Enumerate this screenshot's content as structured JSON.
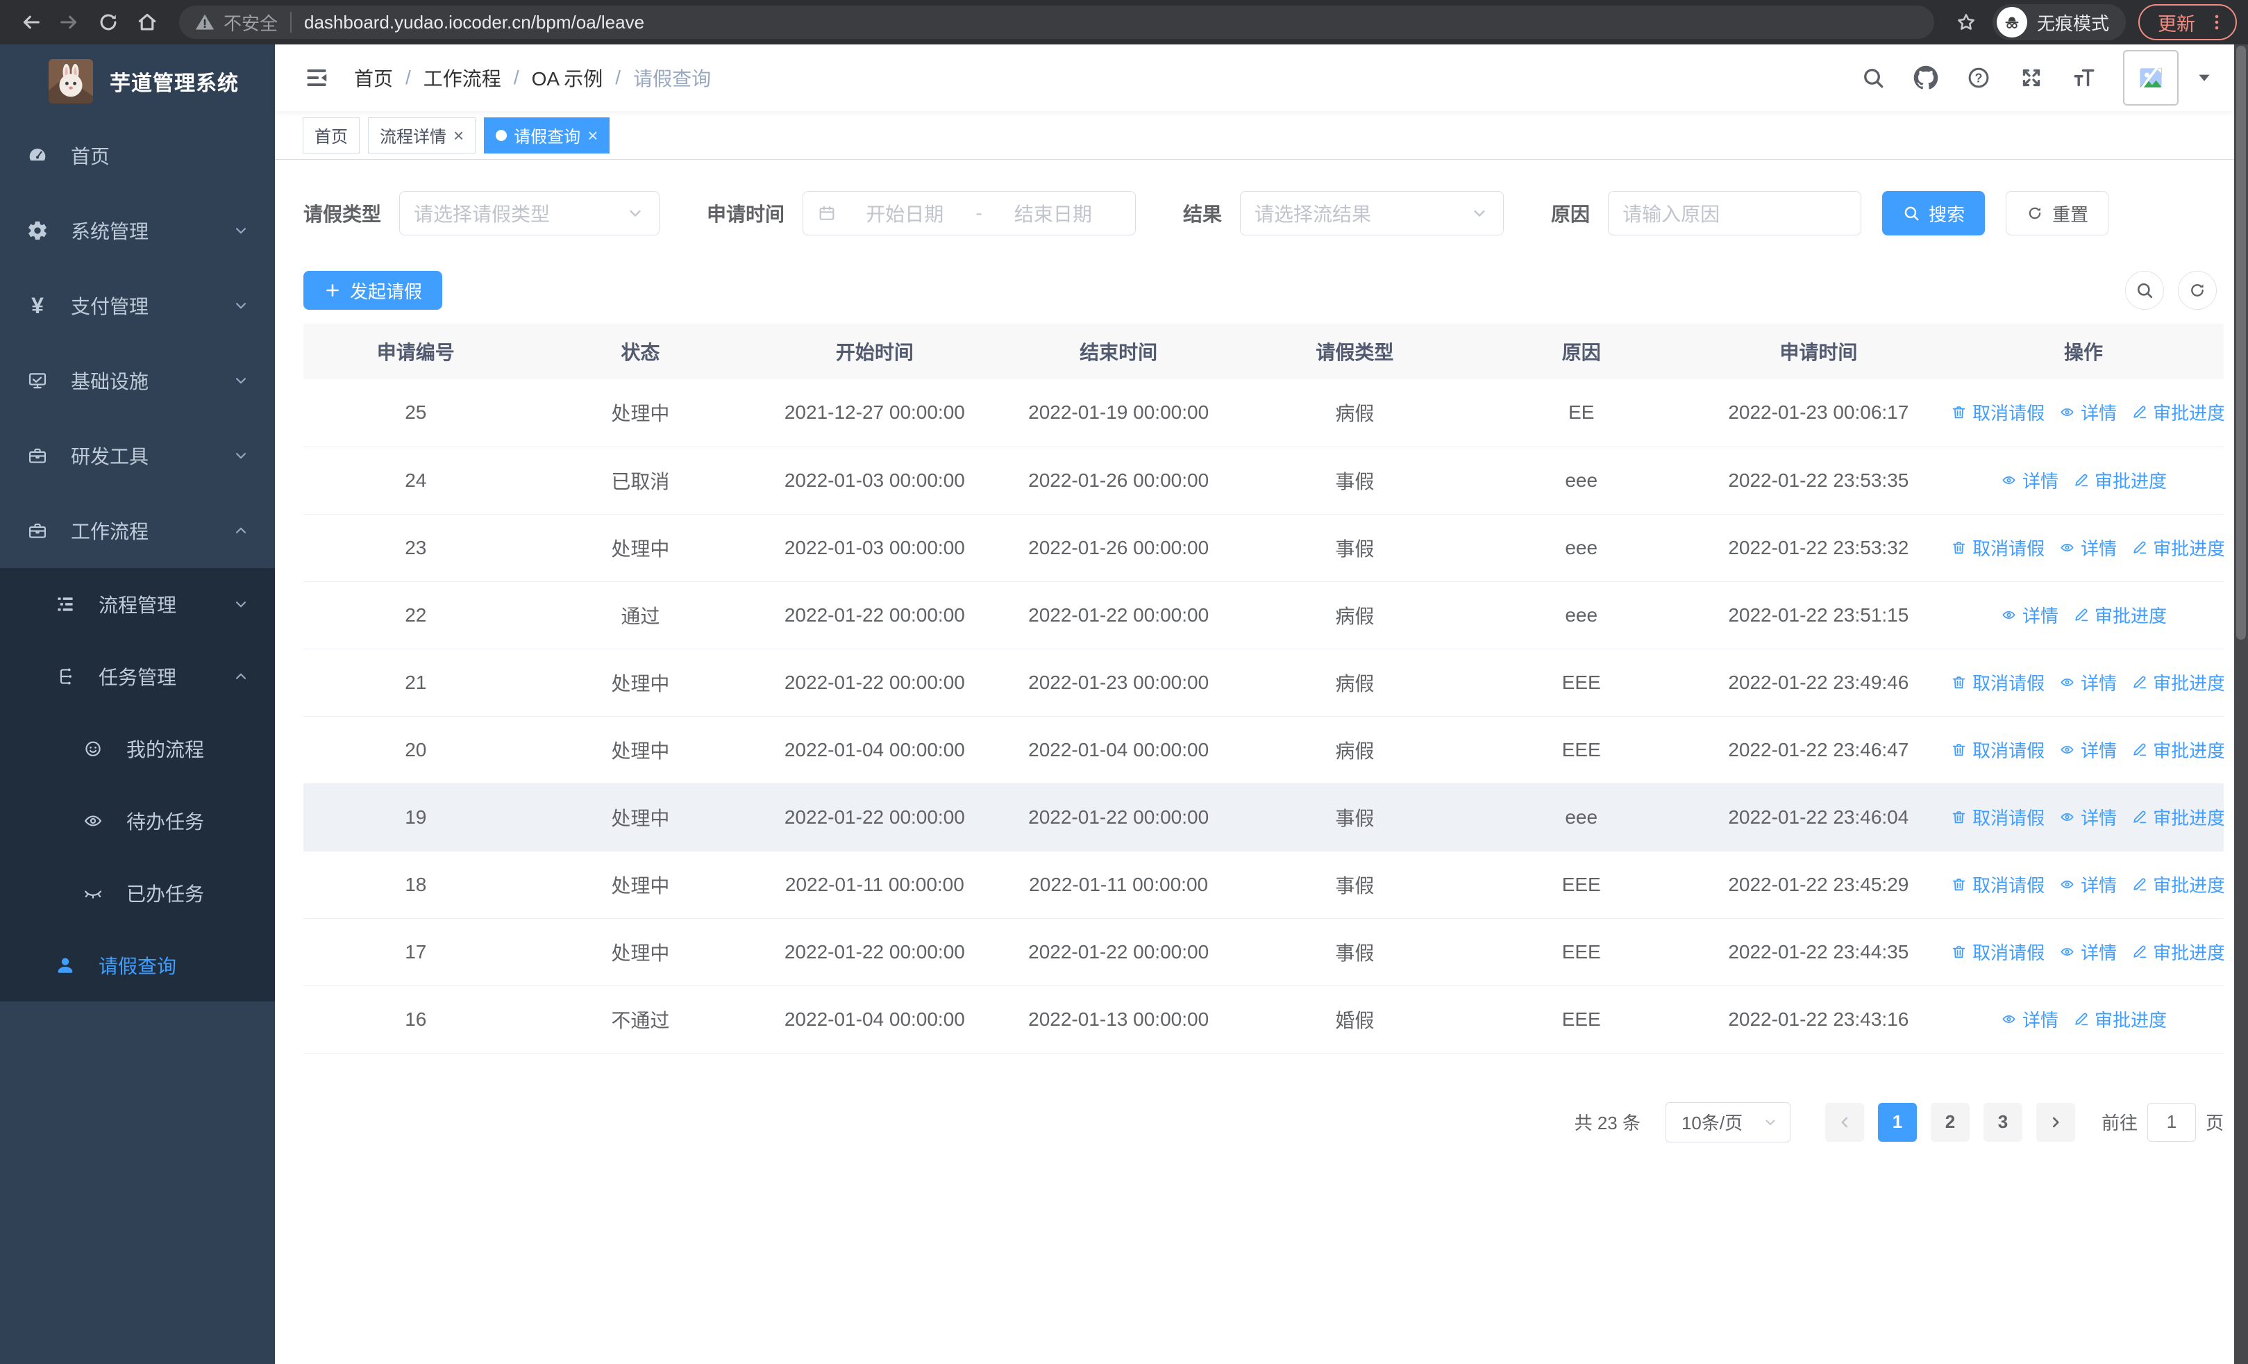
{
  "browser": {
    "security_label": "不安全",
    "url": "dashboard.yudao.iocoder.cn/bpm/oa/leave",
    "incognito_label": "无痕模式",
    "update_label": "更新"
  },
  "sidebar": {
    "title": "芋道管理系统",
    "items": [
      {
        "id": "home",
        "label": "首页",
        "icon": "dashboard-icon",
        "level": 1
      },
      {
        "id": "system-management",
        "label": "系统管理",
        "icon": "gear-icon",
        "level": 1,
        "chevron": "down"
      },
      {
        "id": "payment-management",
        "label": "支付管理",
        "icon": "yen-icon",
        "level": 1,
        "chevron": "down"
      },
      {
        "id": "infrastructure",
        "label": "基础设施",
        "icon": "monitor-icon",
        "level": 1,
        "chevron": "down"
      },
      {
        "id": "dev-tools",
        "label": "研发工具",
        "icon": "briefcase-icon",
        "level": 1,
        "chevron": "down"
      },
      {
        "id": "workflow",
        "label": "工作流程",
        "icon": "briefcase-icon",
        "level": 1,
        "chevron": "up"
      },
      {
        "id": "process-management",
        "label": "流程管理",
        "icon": "tree-list-icon",
        "level": 2,
        "chevron": "down",
        "group": true
      },
      {
        "id": "task-management",
        "label": "任务管理",
        "icon": "flow-icon",
        "level": 2,
        "chevron": "up",
        "group": true
      },
      {
        "id": "my-process",
        "label": "我的流程",
        "icon": "face-icon",
        "level": 3,
        "group": true
      },
      {
        "id": "todo-tasks",
        "label": "待办任务",
        "icon": "eye-open-icon",
        "level": 3,
        "group": true
      },
      {
        "id": "done-tasks",
        "label": "已办任务",
        "icon": "eye-closed-icon",
        "level": 3,
        "group": true
      },
      {
        "id": "leave-query",
        "label": "请假查询",
        "icon": "user-icon",
        "level": 2,
        "group": true,
        "active": true
      }
    ]
  },
  "navbar": {
    "breadcrumb": [
      "首页",
      "工作流程",
      "OA 示例",
      "请假查询"
    ],
    "separator": "/"
  },
  "tabs": [
    {
      "label": "首页",
      "closable": false,
      "active": false
    },
    {
      "label": "流程详情",
      "closable": true,
      "active": false
    },
    {
      "label": "请假查询",
      "closable": true,
      "active": true
    }
  ],
  "filters": {
    "leave_type_label": "请假类型",
    "leave_type_placeholder": "请选择请假类型",
    "apply_time_label": "申请时间",
    "start_date_placeholder": "开始日期",
    "range_separator": "-",
    "end_date_placeholder": "结束日期",
    "result_label": "结果",
    "result_placeholder": "请选择流结果",
    "reason_label": "原因",
    "reason_placeholder": "请输入原因",
    "search_button": "搜索",
    "reset_button": "重置"
  },
  "toolbar": {
    "create_button": "发起请假"
  },
  "table": {
    "columns": [
      "申请编号",
      "状态",
      "开始时间",
      "结束时间",
      "请假类型",
      "原因",
      "申请时间",
      "操作"
    ],
    "action_labels": {
      "cancel": "取消请假",
      "detail": "详情",
      "progress": "审批进度"
    },
    "rows": [
      {
        "id": "25",
        "status": "处理中",
        "start": "2021-12-27 00:00:00",
        "end": "2022-01-19 00:00:00",
        "type": "病假",
        "reason": "EE",
        "applied": "2022-01-23 00:06:17",
        "actions": [
          "cancel",
          "detail",
          "progress"
        ],
        "highlight": false
      },
      {
        "id": "24",
        "status": "已取消",
        "start": "2022-01-03 00:00:00",
        "end": "2022-01-26 00:00:00",
        "type": "事假",
        "reason": "eee",
        "applied": "2022-01-22 23:53:35",
        "actions": [
          "detail",
          "progress"
        ],
        "highlight": false
      },
      {
        "id": "23",
        "status": "处理中",
        "start": "2022-01-03 00:00:00",
        "end": "2022-01-26 00:00:00",
        "type": "事假",
        "reason": "eee",
        "applied": "2022-01-22 23:53:32",
        "actions": [
          "cancel",
          "detail",
          "progress"
        ],
        "highlight": false
      },
      {
        "id": "22",
        "status": "通过",
        "start": "2022-01-22 00:00:00",
        "end": "2022-01-22 00:00:00",
        "type": "病假",
        "reason": "eee",
        "applied": "2022-01-22 23:51:15",
        "actions": [
          "detail",
          "progress"
        ],
        "highlight": false
      },
      {
        "id": "21",
        "status": "处理中",
        "start": "2022-01-22 00:00:00",
        "end": "2022-01-23 00:00:00",
        "type": "病假",
        "reason": "EEE",
        "applied": "2022-01-22 23:49:46",
        "actions": [
          "cancel",
          "detail",
          "progress"
        ],
        "highlight": false
      },
      {
        "id": "20",
        "status": "处理中",
        "start": "2022-01-04 00:00:00",
        "end": "2022-01-04 00:00:00",
        "type": "病假",
        "reason": "EEE",
        "applied": "2022-01-22 23:46:47",
        "actions": [
          "cancel",
          "detail",
          "progress"
        ],
        "highlight": false
      },
      {
        "id": "19",
        "status": "处理中",
        "start": "2022-01-22 00:00:00",
        "end": "2022-01-22 00:00:00",
        "type": "事假",
        "reason": "eee",
        "applied": "2022-01-22 23:46:04",
        "actions": [
          "cancel",
          "detail",
          "progress"
        ],
        "highlight": true
      },
      {
        "id": "18",
        "status": "处理中",
        "start": "2022-01-11 00:00:00",
        "end": "2022-01-11 00:00:00",
        "type": "事假",
        "reason": "EEE",
        "applied": "2022-01-22 23:45:29",
        "actions": [
          "cancel",
          "detail",
          "progress"
        ],
        "highlight": false
      },
      {
        "id": "17",
        "status": "处理中",
        "start": "2022-01-22 00:00:00",
        "end": "2022-01-22 00:00:00",
        "type": "事假",
        "reason": "EEE",
        "applied": "2022-01-22 23:44:35",
        "actions": [
          "cancel",
          "detail",
          "progress"
        ],
        "highlight": false
      },
      {
        "id": "16",
        "status": "不通过",
        "start": "2022-01-04 00:00:00",
        "end": "2022-01-13 00:00:00",
        "type": "婚假",
        "reason": "EEE",
        "applied": "2022-01-22 23:43:16",
        "actions": [
          "detail",
          "progress"
        ],
        "highlight": false
      }
    ]
  },
  "pagination": {
    "total": "共 23 条",
    "page_size": "10条/页",
    "pages": [
      "1",
      "2",
      "3"
    ],
    "active_page": "1",
    "goto_label": "前往",
    "goto_value": "1",
    "page_label": "页"
  },
  "colors": {
    "primary": "#409eff",
    "sidebar_bg": "#304156",
    "submenu_bg": "#1f2d3d",
    "update_accent": "#f28b82"
  }
}
